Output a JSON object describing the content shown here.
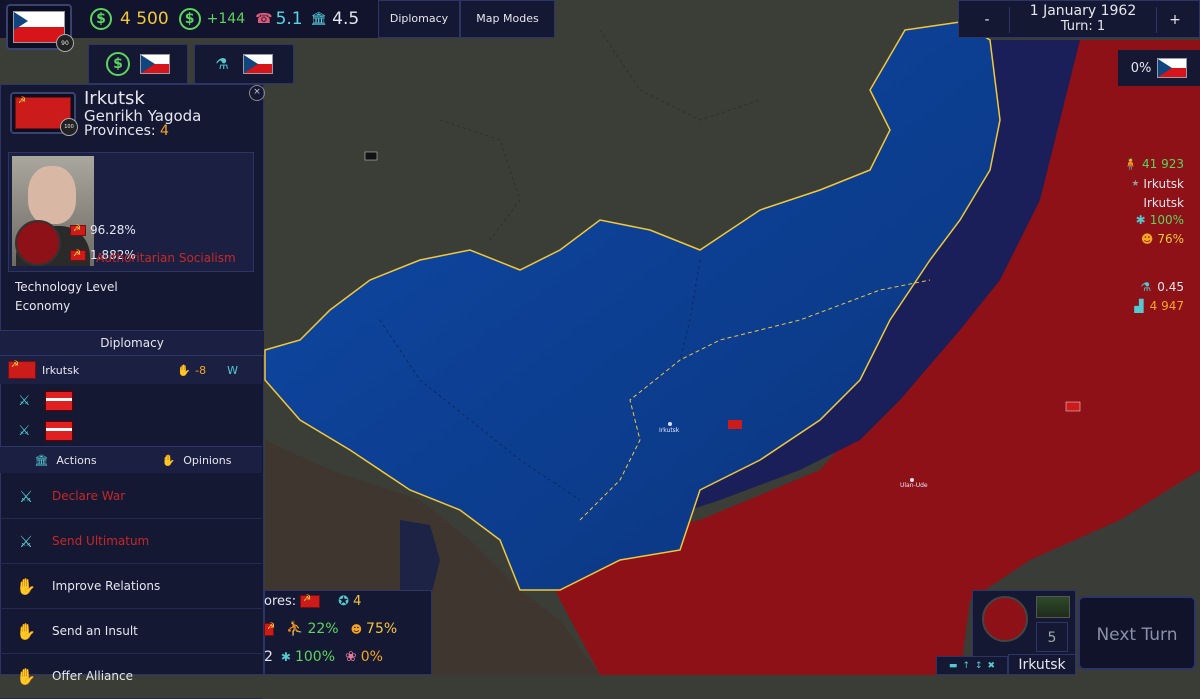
{
  "top_bar": {
    "money": "4 500",
    "income": "+144",
    "phone_value": "5.1",
    "building_value": "4.5",
    "diplomacy_tab": "Diplomacy",
    "map_modes_tab": "Map Modes",
    "player_flag_badge": "90"
  },
  "date_panel": {
    "date": "1 January 1962",
    "turn": "Turn: 1",
    "minus": "-",
    "plus": "+"
  },
  "right_top": {
    "percent": "0%"
  },
  "country": {
    "name": "Irkutsk",
    "leader": "Genrikh Yagoda",
    "provinces_label": "Provinces:",
    "provinces_value": "4",
    "flag_badge": "100",
    "population": "41 923",
    "capital": "Irkutsk",
    "region": "Irkutsk",
    "stability": "100%",
    "happiness": "76%",
    "support_1": "96.28%",
    "support_2": "1.882%",
    "ideology": "Authoritarian Socialism",
    "tech_label": "Technology Level",
    "tech_value": "0.45",
    "economy_label": "Economy",
    "economy_value": "4 947"
  },
  "diplomacy": {
    "header": "Diplomacy",
    "relation_country": "Irkutsk",
    "relation_value": "-8",
    "relation_letter": "W",
    "actions_tab": "Actions",
    "opinions_tab": "Opinions",
    "actions": [
      {
        "label": "Declare War"
      },
      {
        "label": "Send Ultimatum"
      },
      {
        "label": "Improve Relations"
      },
      {
        "label": "Send an Insult"
      },
      {
        "label": "Offer Alliance"
      }
    ]
  },
  "bottom_stats": {
    "label_partial": "ores:",
    "count": "4",
    "pct_1": "22%",
    "pct_2": "75%",
    "num_partial": "2",
    "pct_3": "100%",
    "pct_4": "0%"
  },
  "bottom_right": {
    "number": "5",
    "next_turn": "Next Turn",
    "selected_name": "Irkutsk"
  },
  "map_labels": {
    "city_1": "Irkutsk",
    "city_2": "Ulan-Ude"
  },
  "colors": {
    "panel_bg": "#141833",
    "blue_territory": "#0d3a8a",
    "red_territory": "#8d1117",
    "navy_territory": "#1a1f5a",
    "accent_teal": "#55c9d0"
  }
}
